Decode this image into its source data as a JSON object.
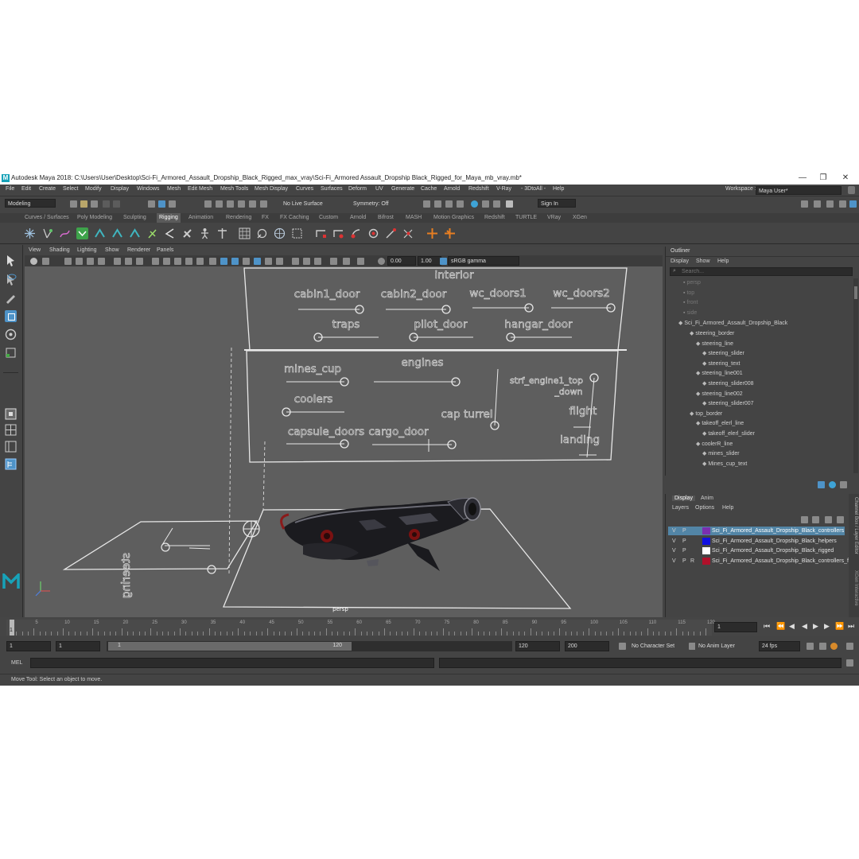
{
  "title_bar": {
    "app_logo": "M",
    "text": "Autodesk Maya 2018: C:\\Users\\User\\Desktop\\Sci-Fi_Armored_Assault_Dropship_Black_Rigged_max_vray\\Sci-Fi_Armored Assault_Dropship Black_Rigged_for_Maya_mb_vray.mb*",
    "minimize": "—",
    "restore": "❐",
    "close": "✕"
  },
  "menu": [
    "File",
    "Edit",
    "Create",
    "Select",
    "Modify",
    "Display",
    "Windows",
    "Mesh",
    "Edit Mesh",
    "Mesh Tools",
    "Mesh Display",
    "Curves",
    "Surfaces",
    "Deform",
    "UV",
    "Generate",
    "Cache",
    "Arnold",
    "Redshift",
    "V-Ray",
    "- 3DtoAll -",
    "Help"
  ],
  "workspace": {
    "label": "Workspace :",
    "value": "Maya User*"
  },
  "status_line": {
    "mode": "Modeling",
    "live_surface": "No Live Surface",
    "symmetry": "Symmetry: Off",
    "sign_in": "Sign In"
  },
  "shelf_tabs": [
    "Curves / Surfaces",
    "Poly Modeling",
    "Sculpting",
    "Rigging",
    "Animation",
    "Rendering",
    "FX",
    "FX Caching",
    "Custom",
    "Arnold",
    "Bifrost",
    "MASH",
    "Motion Graphics",
    "Redshift",
    "TURTLE",
    "VRay",
    "XGen"
  ],
  "active_shelf_tab": "Rigging",
  "panel_menu": [
    "View",
    "Shading",
    "Lighting",
    "Show",
    "Renderer",
    "Panels"
  ],
  "panel_tools": {
    "exposure": "0.00",
    "gamma": "1.00",
    "color_space": "sRGB gamma"
  },
  "viewport": {
    "camera_label": "persp",
    "interior_box": {
      "title": "interior",
      "labels": [
        "cabin1_door",
        "cabin2_door",
        "wc_doors1",
        "wc_doors2",
        "traps",
        "pilot_door",
        "hangar_door"
      ]
    },
    "lower_box": {
      "labels": [
        "mines_cup",
        "engines",
        "strf_engine1_top\n_down",
        "coolers",
        "cap turrel",
        "flight",
        "capsule_doors",
        "cargo_door",
        "landing"
      ]
    },
    "floor_label": "steering"
  },
  "outliner": {
    "title": "Outliner",
    "menu": [
      "Display",
      "Show",
      "Help"
    ],
    "search_placeholder": "Search...",
    "items": [
      {
        "label": "persp",
        "dim": true
      },
      {
        "label": "top",
        "dim": true
      },
      {
        "label": "front",
        "dim": true
      },
      {
        "label": "side",
        "dim": true
      },
      {
        "label": "Sci_Fi_Armored_Assault_Dropship_Black",
        "dim": false
      },
      {
        "label": "steering_border",
        "dim": false
      },
      {
        "label": "steering_line",
        "dim": false
      },
      {
        "label": "steering_slider",
        "dim": false
      },
      {
        "label": "steering_text",
        "dim": false
      },
      {
        "label": "steering_line001",
        "dim": false
      },
      {
        "label": "steering_slider008",
        "dim": false
      },
      {
        "label": "steering_line002",
        "dim": false
      },
      {
        "label": "steering_slider007",
        "dim": false
      },
      {
        "label": "top_border",
        "dim": false
      },
      {
        "label": "takeoff_elerl_line",
        "dim": false
      },
      {
        "label": "takeoff_elerl_slider",
        "dim": false
      },
      {
        "label": "coolerR_line",
        "dim": false
      },
      {
        "label": "mines_slider",
        "dim": false
      },
      {
        "label": "Mines_cup_text",
        "dim": false
      }
    ]
  },
  "layer_editor": {
    "tabs": [
      "Display",
      "Anim"
    ],
    "menu": [
      "Layers",
      "Options",
      "Help"
    ],
    "side_tabs": [
      "Channel Box / Layer Editor",
      "XGen Interactive"
    ],
    "layers": [
      {
        "v": "V",
        "p": "P",
        "r": "",
        "color": "#7a2fb0",
        "name": "Sci_Fi_Armored_Assault_Dropship_Black_controllers",
        "selected": true
      },
      {
        "v": "V",
        "p": "P",
        "r": "",
        "color": "#1010e0",
        "name": "Sci_Fi_Armored_Assault_Dropship_Black_helpers",
        "selected": false
      },
      {
        "v": "V",
        "p": "P",
        "r": "",
        "color": "#ffffff",
        "name": "Sci_Fi_Armored_Assault_Dropship_Black_rigged",
        "selected": false
      },
      {
        "v": "V",
        "p": "P",
        "r": "R",
        "color": "#b0102a",
        "name": "Sci_Fi_Armored_Assault_Dropship_Black_controllers_freeze",
        "selected": false
      }
    ]
  },
  "timeline": {
    "ticks": [
      "1",
      "5",
      "10",
      "15",
      "20",
      "25",
      "30",
      "35",
      "40",
      "45",
      "50",
      "55",
      "60",
      "65",
      "70",
      "75",
      "80",
      "85",
      "90",
      "95",
      "100",
      "105",
      "110",
      "115",
      "120"
    ],
    "current_frame": "1",
    "frame_field": "1"
  },
  "range_bar": {
    "start": "1",
    "start2": "1",
    "slider_start": "1",
    "slider_end": "120",
    "end": "120",
    "end2": "200",
    "character_set": "No Character Set",
    "anim_layer": "No Anim Layer",
    "fps": "24 fps"
  },
  "command_line": {
    "label": "MEL"
  },
  "help_line": "Move Tool: Select an object to move."
}
